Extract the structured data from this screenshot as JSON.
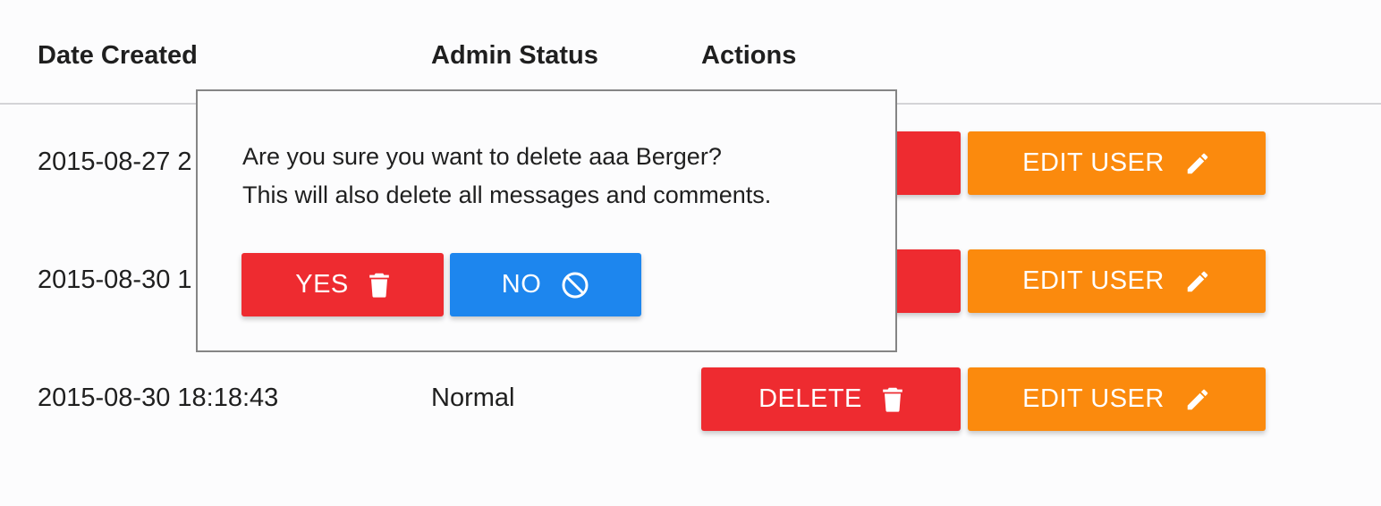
{
  "table": {
    "headers": {
      "date_created": "Date Created",
      "admin_status": "Admin Status",
      "actions": "Actions"
    },
    "rows": [
      {
        "date_created": "2015-08-27 2",
        "admin_status": "",
        "delete_label": "",
        "edit_label": "EDIT USER"
      },
      {
        "date_created": "2015-08-30 1",
        "admin_status": "",
        "delete_label": "",
        "edit_label": "EDIT USER"
      },
      {
        "date_created": "2015-08-30 18:18:43",
        "admin_status": "Normal",
        "delete_label": "DELETE",
        "edit_label": "EDIT USER"
      }
    ]
  },
  "dialog": {
    "message_line1": "Are you sure you want to delete aaa Berger?",
    "message_line2": "This will also delete all messages and comments.",
    "yes_label": "YES",
    "no_label": "NO"
  },
  "icons": {
    "delete": "trash-icon",
    "edit": "pencil-icon",
    "no": "block-icon"
  },
  "colors": {
    "delete": "#ee2b30",
    "edit": "#fb8a0d",
    "no": "#1d86ee"
  }
}
